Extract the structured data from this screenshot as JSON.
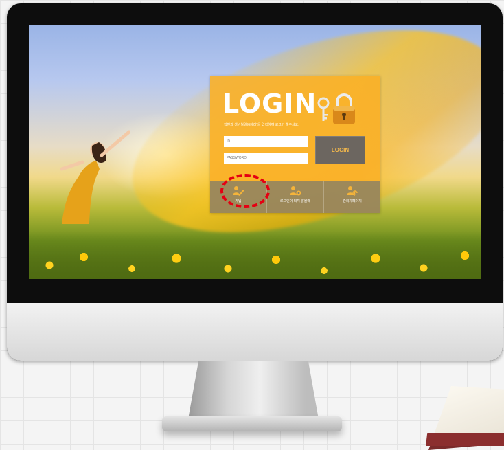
{
  "login": {
    "title": "LOGIN",
    "subtitle": "학번과 생년월일(6자리)을 입력하여 로그인 해주세요.",
    "id_placeholder": "ID",
    "password_placeholder": "PASSWORD",
    "button_label": "LOGIN"
  },
  "bottom_menu": [
    {
      "label": "가입",
      "icon": "user-pen-icon"
    },
    {
      "label": "로그인이 되지 않을때",
      "icon": "user-x-icon"
    },
    {
      "label": "관리자페이지",
      "icon": "user-admin-icon"
    }
  ],
  "colors": {
    "accent": "#FAB028",
    "button_bg": "#6C6660",
    "highlight": "#E50012"
  }
}
